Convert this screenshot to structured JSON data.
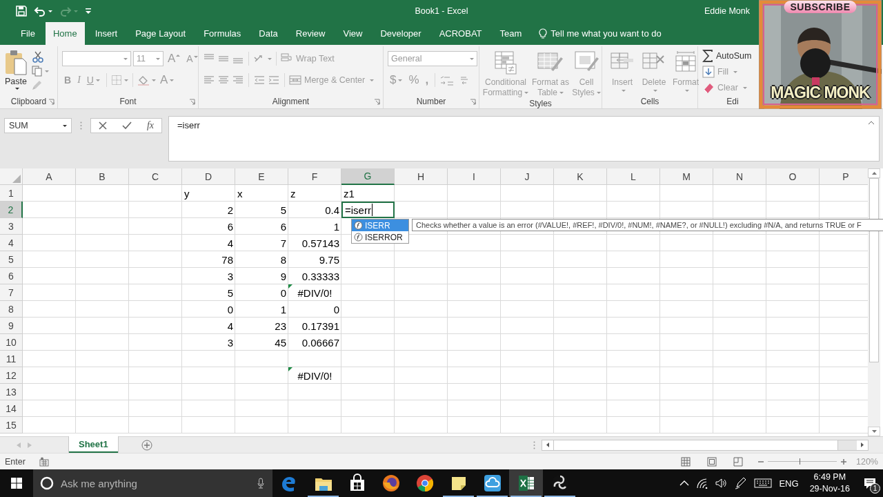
{
  "title_bar": {
    "title": "Book1 - Excel",
    "user": "Eddie Monk",
    "redo_disabled": true
  },
  "menu_tabs": [
    {
      "label": "File",
      "selected": false
    },
    {
      "label": "Home",
      "selected": true
    },
    {
      "label": "Insert",
      "selected": false
    },
    {
      "label": "Page Layout",
      "selected": false
    },
    {
      "label": "Formulas",
      "selected": false
    },
    {
      "label": "Data",
      "selected": false
    },
    {
      "label": "Review",
      "selected": false
    },
    {
      "label": "View",
      "selected": false
    },
    {
      "label": "Developer",
      "selected": false
    },
    {
      "label": "ACROBAT",
      "selected": false
    },
    {
      "label": "Team",
      "selected": false
    }
  ],
  "tell_me": "Tell me what you want to do",
  "ribbon": {
    "disabled": true,
    "groups": [
      {
        "kind": "clipboard",
        "label": "Clipboard",
        "paste": "Paste"
      },
      {
        "kind": "font",
        "label": "Font",
        "size": "11",
        "grow": "A",
        "shrink": "A",
        "bold": "B",
        "italic": "I",
        "underline": "U",
        "tint": "A"
      },
      {
        "kind": "alignment",
        "label": "Alignment",
        "wrap": "Wrap Text",
        "merge": "Merge & Center"
      },
      {
        "kind": "number",
        "label": "Number",
        "format": "General",
        "currency": "$",
        "percent": "%",
        "comma": ","
      },
      {
        "kind": "styles",
        "label": "Styles",
        "buttons": [
          "Conditional Formatting",
          "Format as Table",
          "Cell Styles"
        ]
      },
      {
        "kind": "cells",
        "label": "Cells",
        "buttons": [
          "Insert",
          "Delete",
          "Format"
        ]
      },
      {
        "kind": "editing",
        "label": "Edi",
        "buttons": [
          "AutoSum",
          "Fill",
          "Clear"
        ]
      }
    ]
  },
  "formula_bar": {
    "name_box": "SUM",
    "fx": "fx",
    "formula": "=iserr"
  },
  "sheet": {
    "columns": [
      {
        "label": "A",
        "selected": false
      },
      {
        "label": "B",
        "selected": false
      },
      {
        "label": "C",
        "selected": false
      },
      {
        "label": "D",
        "selected": false
      },
      {
        "label": "E",
        "selected": false
      },
      {
        "label": "F",
        "selected": false
      },
      {
        "label": "G",
        "selected": true
      },
      {
        "label": "H",
        "selected": false
      },
      {
        "label": "I",
        "selected": false
      },
      {
        "label": "J",
        "selected": false
      },
      {
        "label": "K",
        "selected": false
      },
      {
        "label": "L",
        "selected": false
      },
      {
        "label": "M",
        "selected": false
      },
      {
        "label": "N",
        "selected": false
      },
      {
        "label": "O",
        "selected": false
      },
      {
        "label": "P",
        "selected": false
      }
    ],
    "rows": [
      {
        "label": "1",
        "selected": false,
        "cells": [
          null,
          null,
          null,
          {
            "value": "y",
            "kind": "text",
            "flagged": false
          },
          {
            "value": "x",
            "kind": "text",
            "flagged": false
          },
          {
            "value": "z",
            "kind": "text",
            "flagged": false
          },
          {
            "value": "z1",
            "kind": "text",
            "flagged": false
          }
        ]
      },
      {
        "label": "2",
        "selected": true,
        "cells": [
          null,
          null,
          null,
          {
            "value": "2",
            "kind": "number",
            "flagged": false
          },
          {
            "value": "5",
            "kind": "number",
            "flagged": false
          },
          {
            "value": "0.4",
            "kind": "number",
            "flagged": false
          },
          {
            "value": "=iserr",
            "kind": "editing",
            "flagged": false
          }
        ]
      },
      {
        "label": "3",
        "selected": false,
        "cells": [
          null,
          null,
          null,
          {
            "value": "6",
            "kind": "number",
            "flagged": false
          },
          {
            "value": "6",
            "kind": "number",
            "flagged": false
          },
          {
            "value": "1",
            "kind": "number",
            "flagged": false
          }
        ]
      },
      {
        "label": "4",
        "selected": false,
        "cells": [
          null,
          null,
          null,
          {
            "value": "4",
            "kind": "number",
            "flagged": false
          },
          {
            "value": "7",
            "kind": "number",
            "flagged": false
          },
          {
            "value": "0.57143",
            "kind": "number",
            "flagged": false
          }
        ]
      },
      {
        "label": "5",
        "selected": false,
        "cells": [
          null,
          null,
          null,
          {
            "value": "78",
            "kind": "number",
            "flagged": false
          },
          {
            "value": "8",
            "kind": "number",
            "flagged": false
          },
          {
            "value": "9.75",
            "kind": "number",
            "flagged": false
          }
        ]
      },
      {
        "label": "6",
        "selected": false,
        "cells": [
          null,
          null,
          null,
          {
            "value": "3",
            "kind": "number",
            "flagged": false
          },
          {
            "value": "9",
            "kind": "number",
            "flagged": false
          },
          {
            "value": "0.33333",
            "kind": "number",
            "flagged": false
          }
        ]
      },
      {
        "label": "7",
        "selected": false,
        "cells": [
          null,
          null,
          null,
          {
            "value": "5",
            "kind": "number",
            "flagged": false
          },
          {
            "value": "0",
            "kind": "number",
            "flagged": false
          },
          {
            "value": "#DIV/0!",
            "kind": "error",
            "flagged": true
          }
        ]
      },
      {
        "label": "8",
        "selected": false,
        "cells": [
          null,
          null,
          null,
          {
            "value": "0",
            "kind": "number",
            "flagged": false
          },
          {
            "value": "1",
            "kind": "number",
            "flagged": false
          },
          {
            "value": "0",
            "kind": "number",
            "flagged": false
          }
        ]
      },
      {
        "label": "9",
        "selected": false,
        "cells": [
          null,
          null,
          null,
          {
            "value": "4",
            "kind": "number",
            "flagged": false
          },
          {
            "value": "23",
            "kind": "number",
            "flagged": false
          },
          {
            "value": "0.17391",
            "kind": "number",
            "flagged": false
          }
        ]
      },
      {
        "label": "10",
        "selected": false,
        "cells": [
          null,
          null,
          null,
          {
            "value": "3",
            "kind": "number",
            "flagged": false
          },
          {
            "value": "45",
            "kind": "number",
            "flagged": false
          },
          {
            "value": "0.06667",
            "kind": "number",
            "flagged": false
          }
        ]
      },
      {
        "label": "11",
        "selected": false
      },
      {
        "label": "12",
        "selected": false,
        "cells": [
          null,
          null,
          null,
          null,
          null,
          {
            "value": "#DIV/0!",
            "kind": "error",
            "flagged": true
          }
        ]
      },
      {
        "label": "13",
        "selected": false
      },
      {
        "label": "14",
        "selected": false
      },
      {
        "label": "15",
        "selected": false
      }
    ],
    "autocomplete": {
      "items": [
        {
          "label": "ISERR",
          "selected": true
        },
        {
          "label": "ISERROR",
          "selected": false
        }
      ],
      "tooltip": "Checks whether a value is an error (#VALUE!, #REF!, #DIV/0!, #NUM!, #NAME?, or #NULL!) excluding #N/A, and returns TRUE or F"
    }
  },
  "sheet_tabs": [
    {
      "label": "Sheet1",
      "selected": true
    }
  ],
  "status_bar": {
    "mode": "Enter",
    "zoom_slider": {
      "level": 0.47
    },
    "zoom": "120%"
  },
  "taskbar": {
    "search_placeholder": "Ask me anything",
    "apps": [
      {
        "kind": "edge",
        "running": false,
        "active": false
      },
      {
        "kind": "explorer",
        "running": true,
        "active": false
      },
      {
        "kind": "store",
        "running": false,
        "active": false
      },
      {
        "kind": "firefox",
        "running": false,
        "active": false
      },
      {
        "kind": "chrome",
        "running": false,
        "active": false
      },
      {
        "kind": "sticky",
        "running": true,
        "active": false
      },
      {
        "kind": "cloud",
        "running": true,
        "active": false
      },
      {
        "kind": "excel",
        "running": true,
        "active": true
      },
      {
        "kind": "obs",
        "running": true,
        "active": false
      }
    ],
    "language": "ENG",
    "time": "6:49 PM",
    "date": "29-Nov-16",
    "notifications": "1"
  },
  "overlay": {
    "kind": "picture",
    "badge": "SUBSCRIBE",
    "caption": "MAGIC MONK"
  }
}
